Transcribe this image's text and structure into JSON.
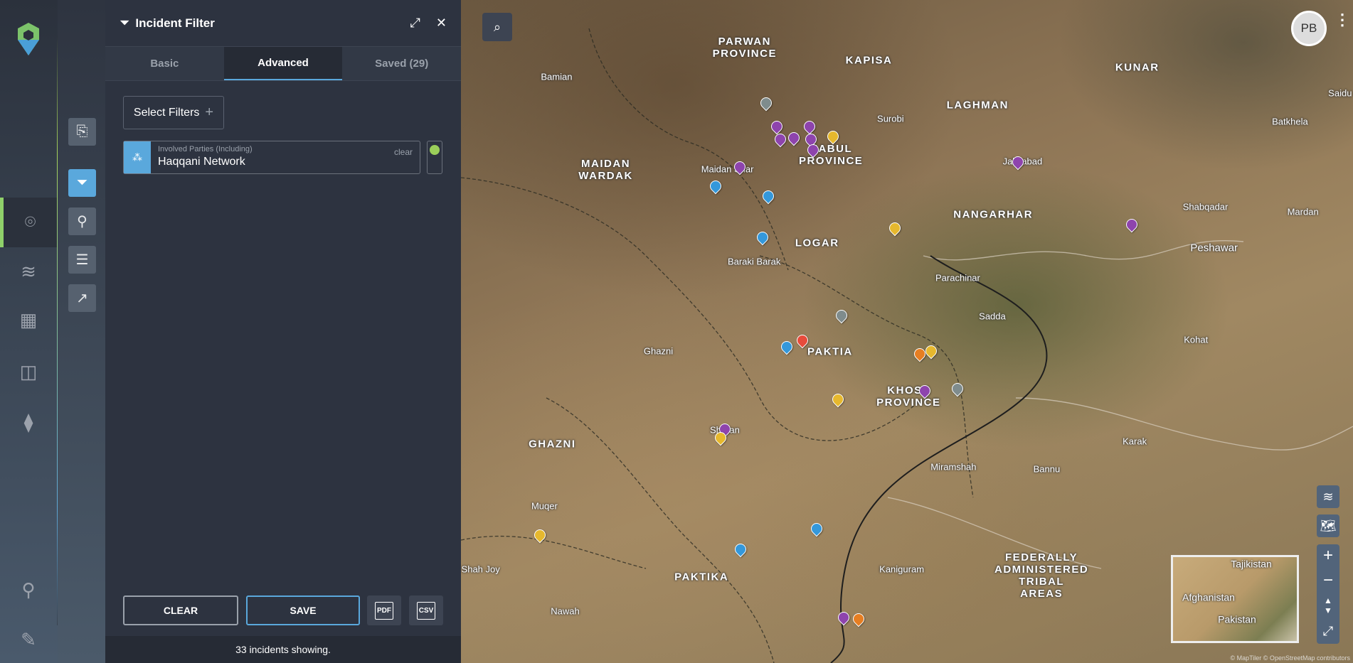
{
  "panel": {
    "title": "Incident Filter",
    "tabs": [
      "Basic",
      "Advanced",
      "Saved (29)"
    ],
    "select_filters": "Select Filters",
    "filter": {
      "label": "Involved Parties (Including)",
      "value": "Haqqani Network",
      "clear": "clear"
    },
    "clear_button": "CLEAR",
    "save_button": "SAVE",
    "pdf_button": "PDF",
    "csv_button": "CSV",
    "status": "33 incidents showing."
  },
  "user": {
    "initials": "PB"
  },
  "map": {
    "labels": [
      "PARWAN\nPROVINCE",
      "KAPISA",
      "KUNAR",
      "Bamian",
      "Surobi",
      "LAGHMAN",
      "Batkhela",
      "Saidu",
      "MAIDAN\nWARDAK",
      "Maidan Shar",
      "KABUL\nPROVINCE",
      "Jalalabad",
      "NANGARHAR",
      "Shabqadar",
      "Mardan",
      "LOGAR",
      "Peshawar",
      "Baraki Barak",
      "Parachinar",
      "Sadda",
      "Kohat",
      "Ghazni",
      "PAKTIA",
      "KHOST\nPROVINCE",
      "Sharan",
      "Karak",
      "GHAZNI",
      "Miramshah",
      "Bannu",
      "Muqer",
      "Shah Joy",
      "PAKTIKA",
      "Kaniguram",
      "FEDERALLY\nADMINISTERED\nTRIBAL\nAREAS",
      "Nawah"
    ],
    "minimap_labels": [
      "Tajikistan",
      "Afghanistan",
      "Pakistan"
    ],
    "attribution": "© MapTiler © OpenStreetMap contributors",
    "marker_colors": {
      "purple": "#8e44ad",
      "blue": "#3498db",
      "yellow": "#e6b82e",
      "gray": "#7f8c8d",
      "red": "#e74c3c",
      "orange": "#e67e22"
    }
  },
  "colors": {
    "accent": "#5aa8dc",
    "active_green": "#9bcf5a"
  }
}
